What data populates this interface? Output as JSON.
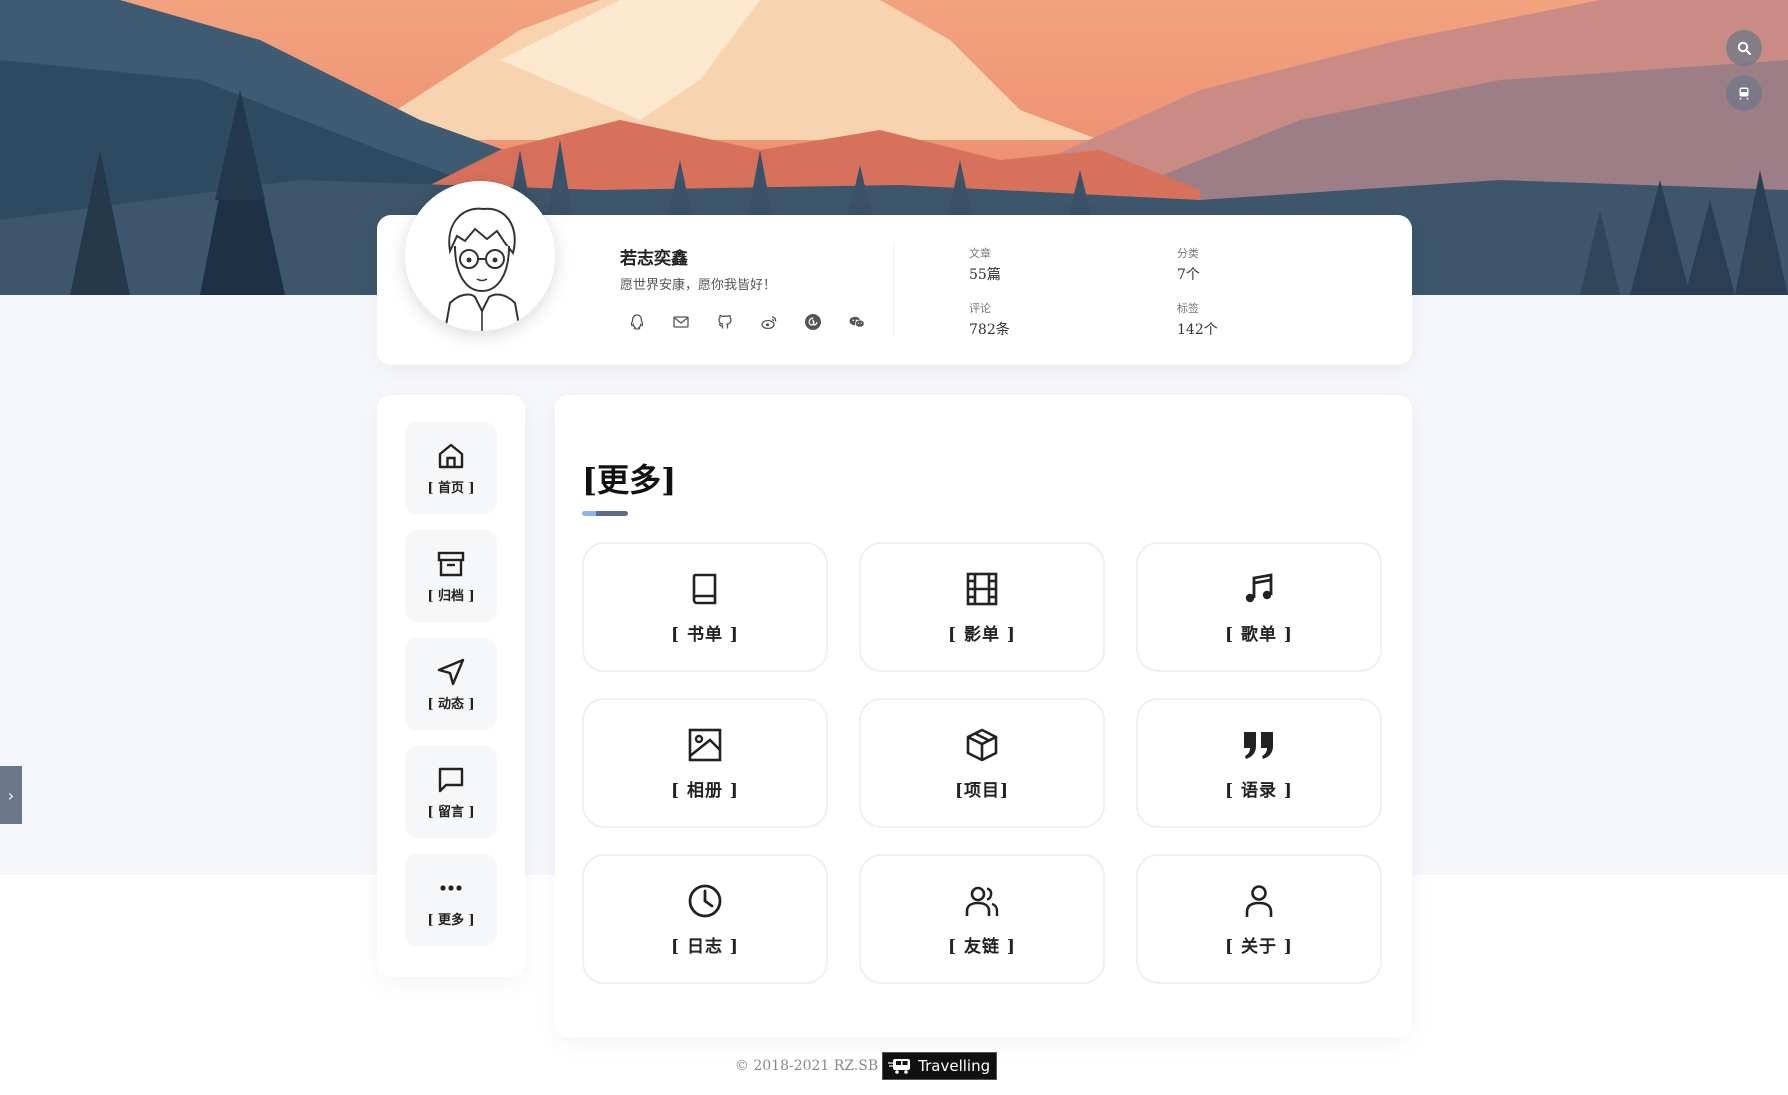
{
  "colors": {
    "accent_light": "#8ab6e6",
    "accent_dark": "#5c6e86",
    "page_bg": "#f6f7fa",
    "card_border": "#eef0f3"
  },
  "header": {
    "search_icon": "search-icon",
    "reader_icon": "train-icon"
  },
  "profile": {
    "name": "若志奕鑫",
    "motto": "愿世界安康，愿你我皆好！",
    "socials": [
      "qq-icon",
      "mail-icon",
      "github-icon",
      "weibo-icon",
      "netease-music-icon",
      "wechat-icon"
    ],
    "stats": [
      {
        "label": "文章",
        "value": "55篇"
      },
      {
        "label": "分类",
        "value": "7个"
      },
      {
        "label": "评论",
        "value": "782条"
      },
      {
        "label": "标签",
        "value": "142个"
      }
    ]
  },
  "nav": {
    "items": [
      {
        "label": "[ 首页 ]",
        "icon": "home-icon"
      },
      {
        "label": "[ 归档 ]",
        "icon": "archive-icon"
      },
      {
        "label": "[ 动态 ]",
        "icon": "send-icon"
      },
      {
        "label": "[ 留言 ]",
        "icon": "message-icon"
      },
      {
        "label": "[ 更多 ]",
        "icon": "more-icon"
      }
    ]
  },
  "main": {
    "title": "[更多]",
    "cards": [
      {
        "label": "[ 书单 ]",
        "icon": "book-icon"
      },
      {
        "label": "[ 影单 ]",
        "icon": "film-icon"
      },
      {
        "label": "[ 歌单 ]",
        "icon": "music-icon"
      },
      {
        "label": "[ 相册 ]",
        "icon": "image-icon"
      },
      {
        "label": "[项目]",
        "icon": "box-icon"
      },
      {
        "label": "[ 语录 ]",
        "icon": "quote-icon"
      },
      {
        "label": "[ 日志 ]",
        "icon": "clock-icon"
      },
      {
        "label": "[ 友链 ]",
        "icon": "users-icon"
      },
      {
        "label": "[ 关于 ]",
        "icon": "user-icon"
      }
    ]
  },
  "footer": {
    "copyright": "© 2018-2021 RZ.SB",
    "badge_text": "Travelling"
  }
}
